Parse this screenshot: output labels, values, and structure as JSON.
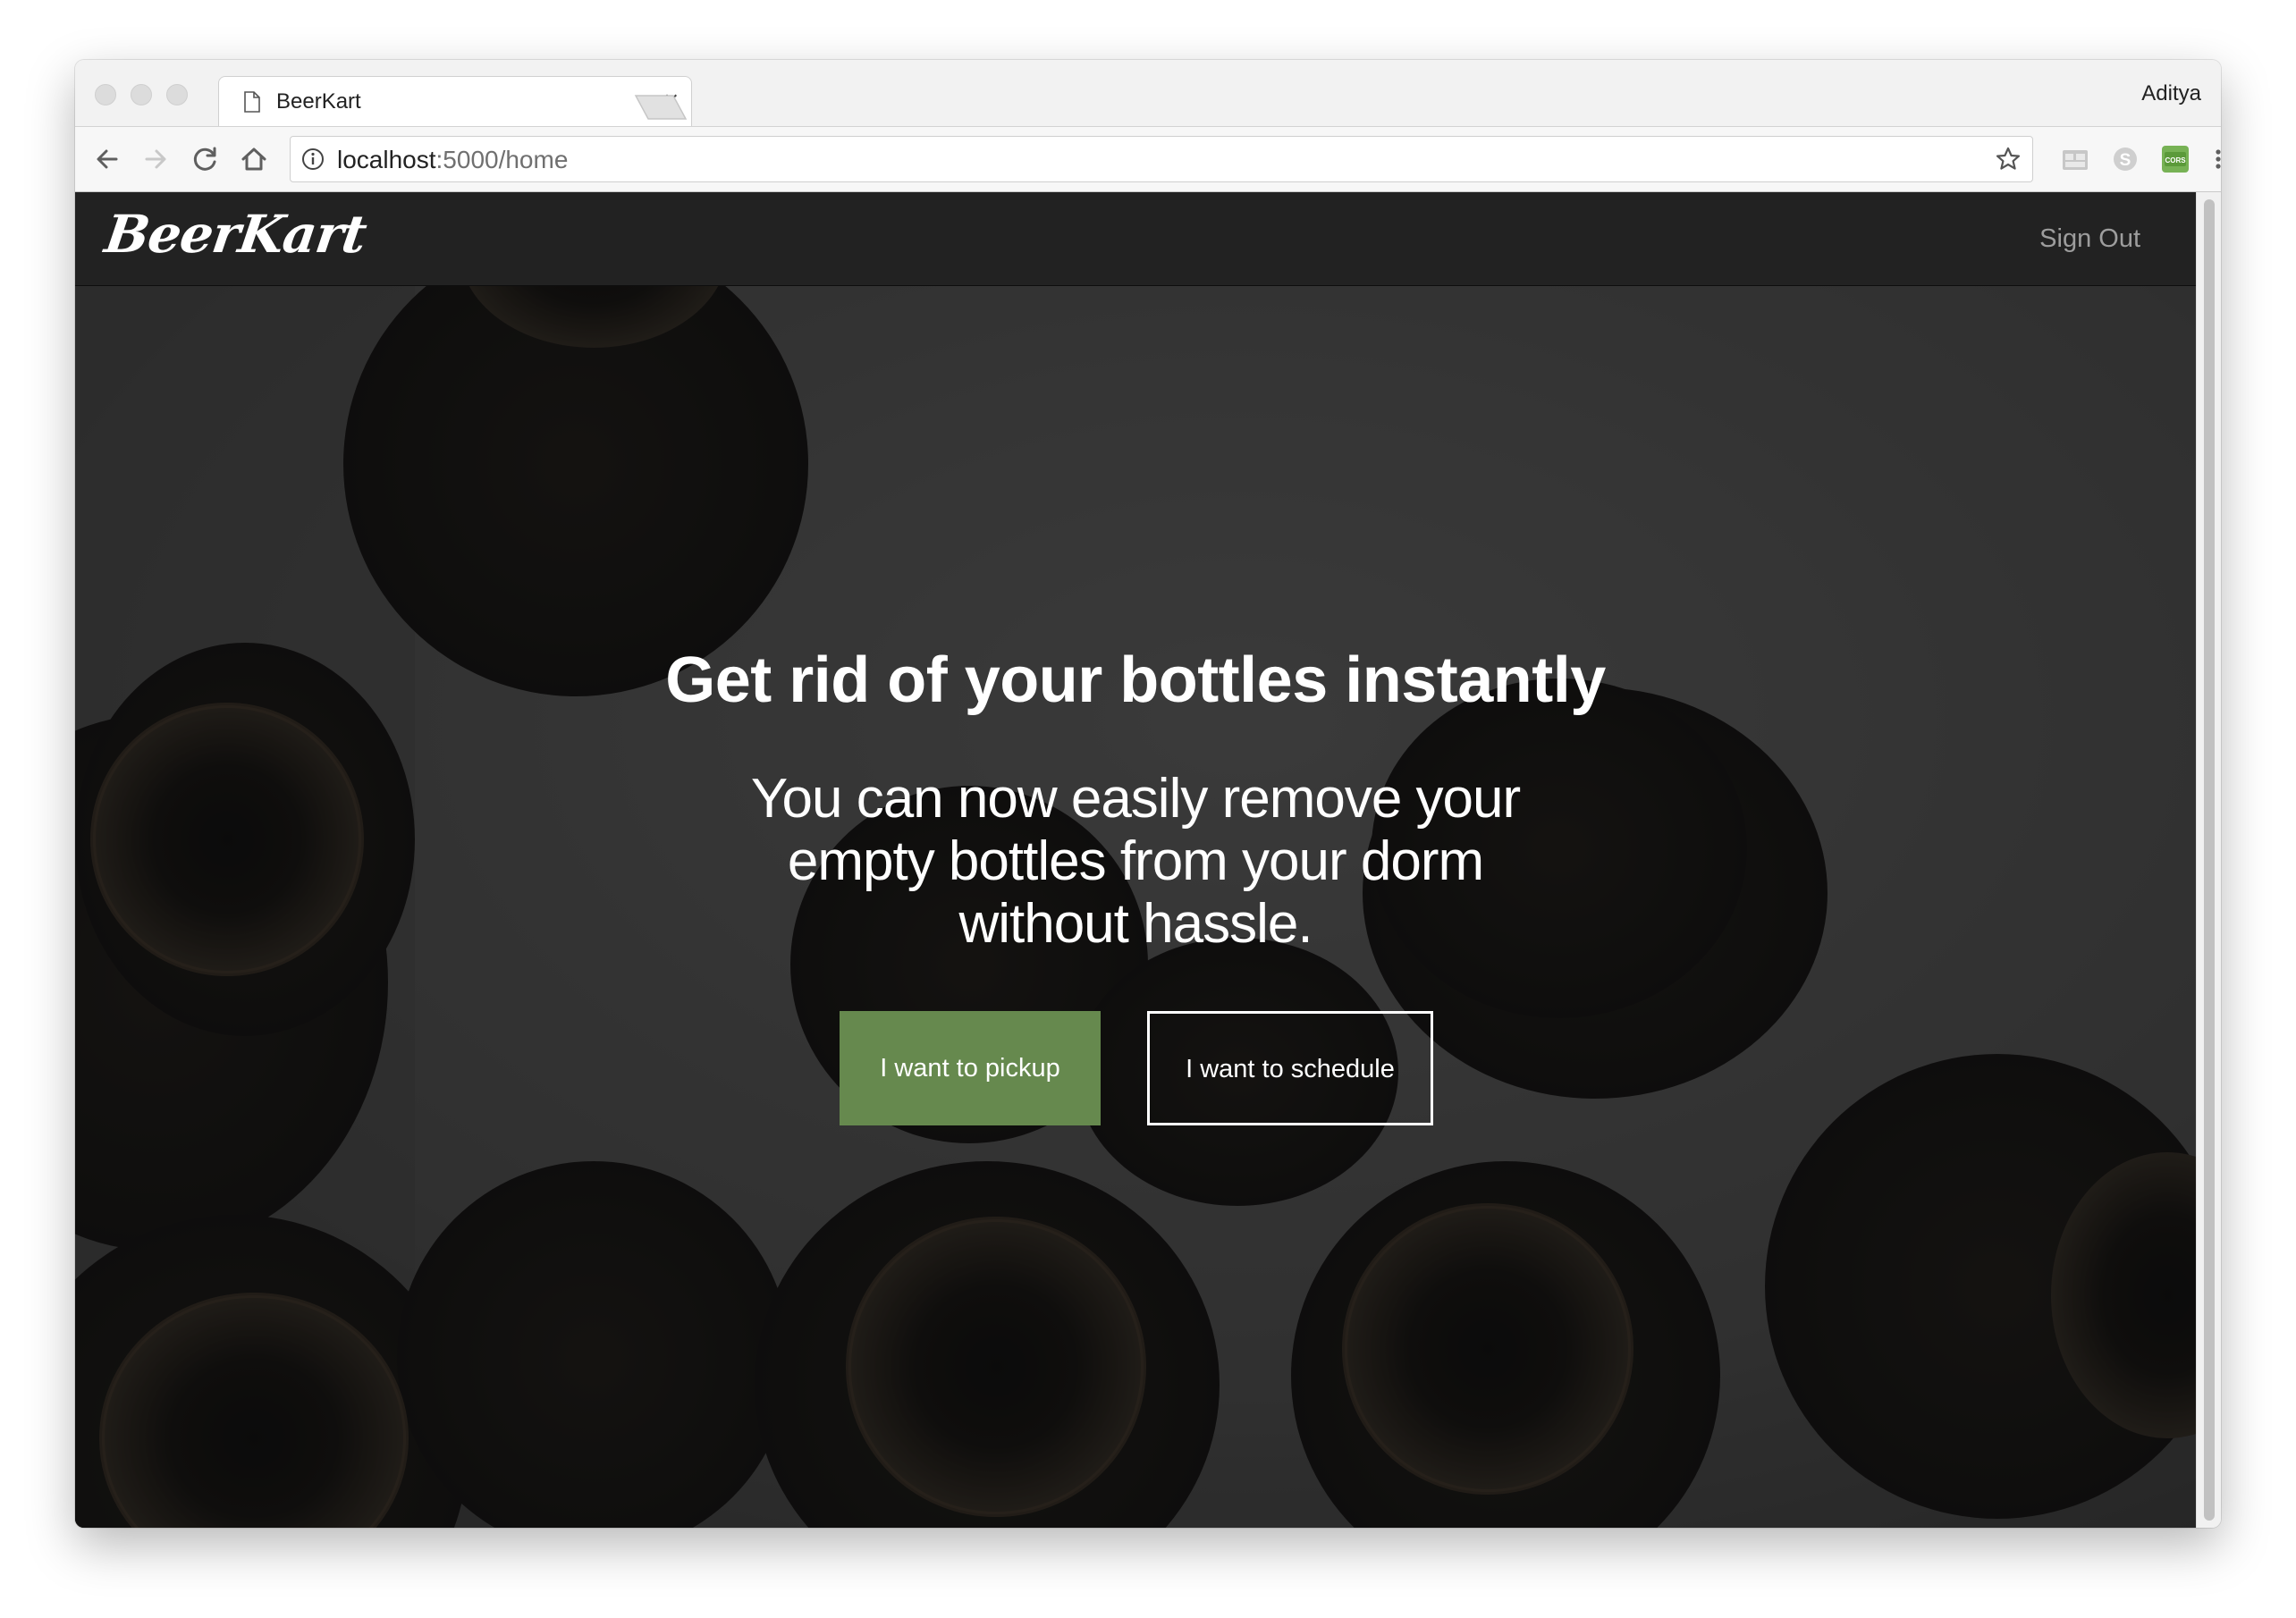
{
  "browser": {
    "tab_title": "BeerKart",
    "profile_name": "Aditya",
    "url_host": "localhost",
    "url_path": ":5000/home",
    "icons": {
      "back": "arrow-left-icon",
      "forward": "arrow-right-icon",
      "reload": "reload-icon",
      "home": "home-icon",
      "info": "info-icon",
      "bookmark": "star-icon",
      "menu": "more-vertical-icon"
    },
    "extension_cors_label": "CORS"
  },
  "site": {
    "brand": "BeerKart",
    "nav_signout": "Sign Out"
  },
  "hero": {
    "title": "Get rid of your bottles instantly",
    "subtitle": "You can now easily remove your empty bottles from your dorm without hassle.",
    "primary_button": "I want to pickup",
    "secondary_button": "I want to schedule"
  },
  "colors": {
    "navbar": "#222222",
    "primary_button": "#66894e",
    "text_on_dark": "#ffffff",
    "nav_link": "#9d9d9d"
  }
}
